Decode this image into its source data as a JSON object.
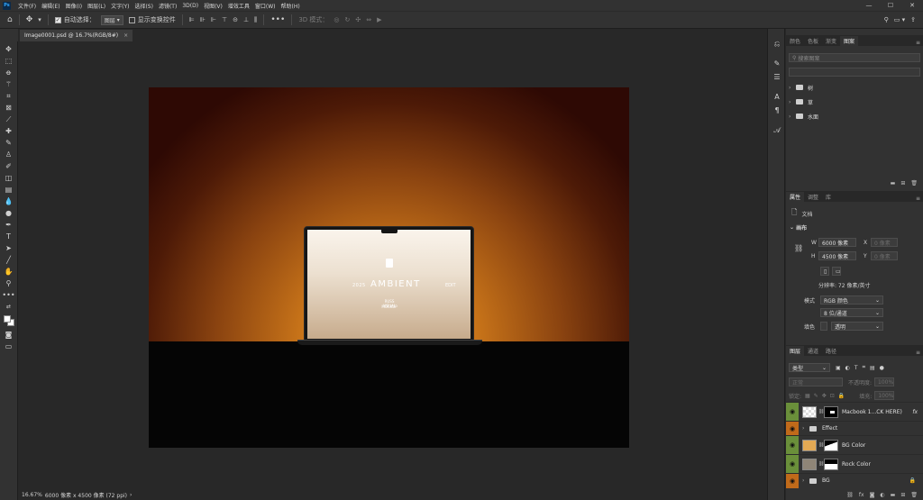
{
  "app": {
    "logo": "Ps"
  },
  "menu": [
    "文件(F)",
    "编辑(E)",
    "图像(I)",
    "图层(L)",
    "文字(Y)",
    "选择(S)",
    "滤镜(T)",
    "3D(D)",
    "视图(V)",
    "增效工具",
    "窗口(W)",
    "帮助(H)"
  ],
  "window_controls": {
    "minimize": "—",
    "maximize": "☐",
    "close": "✕"
  },
  "options": {
    "auto_select_label": "自动选择：",
    "auto_select_value": "图层",
    "show_transform_label": "显示变换控件",
    "mode_3d_label": "3D 模式："
  },
  "document": {
    "tab": "Image0001.psd @ 16.7%(RGB/8#)",
    "close": "×"
  },
  "canvas": {
    "screen_year": "2025",
    "screen_title": "AMBIENT",
    "screen_edit": "EDIT",
    "screen_sub1": "RUSS VISUAL",
    "screen_sub2": "MOCKUP"
  },
  "status": {
    "zoom": "16.67%",
    "size": "6000 像素 x 4500 像素 (72 ppi)",
    "arrow": "›"
  },
  "libraries": {
    "tabs": [
      "颜色",
      "色板",
      "渐变",
      "图案"
    ],
    "active_tab": 3,
    "search_placeholder": "搜索图案",
    "groups": [
      "树",
      "草",
      "水面"
    ]
  },
  "properties": {
    "tabs": [
      "属性",
      "调整",
      "库"
    ],
    "doc_label": "文档",
    "canvas_title": "画布",
    "w_label": "W",
    "w_value": "6000 像素",
    "h_label": "H",
    "h_value": "4500 像素",
    "x_label": "X",
    "x_value": "0 像素",
    "y_label": "Y",
    "y_value": "0 像素",
    "resolution": "分辨率: 72 像素/英寸",
    "mode_label": "模式",
    "mode_value": "RGB 颜色",
    "depth_value": "8 位/通道",
    "fill_label": "填色",
    "fill_value": "透明"
  },
  "layers_panel": {
    "tabs": [
      "图层",
      "通道",
      "路径"
    ],
    "filter_value": "类型",
    "blend_value": "正常",
    "opacity_label": "不透明度:",
    "opacity_value": "100%",
    "lock_label": "锁定:",
    "fill_label": "填充:",
    "fill_value": "100%",
    "layers": [
      {
        "name": "Macbook 1...CK HERE)",
        "fx": "fx",
        "eye_color": "#6a8f3a",
        "thumb": "smart"
      },
      {
        "name": "Effect",
        "eye_color": "#c06a1a",
        "thumb": "folder"
      },
      {
        "name": "BG Color",
        "eye_color": "#6a8f3a",
        "thumb": "#e3a954"
      },
      {
        "name": "Rock Color",
        "eye_color": "#6a8f3a",
        "thumb": "#8f8577"
      },
      {
        "name": "BG",
        "eye_color": "#c06a1a",
        "thumb": "folder"
      }
    ]
  }
}
